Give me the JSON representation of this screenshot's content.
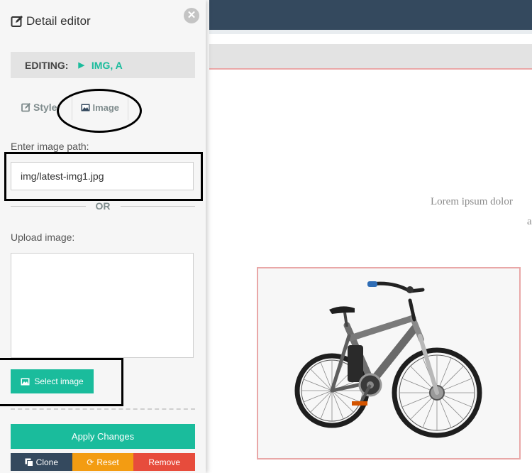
{
  "panel": {
    "title": "Detail editor",
    "close_icon": "close-icon",
    "editing_label": "EDITING:",
    "editing_target": "IMG, A",
    "tabs": [
      {
        "label": "Style",
        "icon": "edit-icon"
      },
      {
        "label": "Image",
        "icon": "image-icon"
      }
    ],
    "path_label": "Enter image path:",
    "path_value": "img/latest-img1.jpg",
    "or_text": "OR",
    "upload_label": "Upload image:",
    "select_image_label": "Select image",
    "apply_label": "Apply Changes",
    "actions": {
      "clone": "Clone",
      "reset": "Reset",
      "remove": "Remove"
    }
  },
  "preview": {
    "lorem_line1": "Lorem ipsum dolor",
    "lorem_line2": "a",
    "image_subject": "electric-bicycle"
  },
  "colors": {
    "accent": "#1abc9c",
    "navy": "#34495e",
    "orange": "#f39c12",
    "red": "#e74c3c",
    "highlight_border": "#e9a7a7"
  }
}
